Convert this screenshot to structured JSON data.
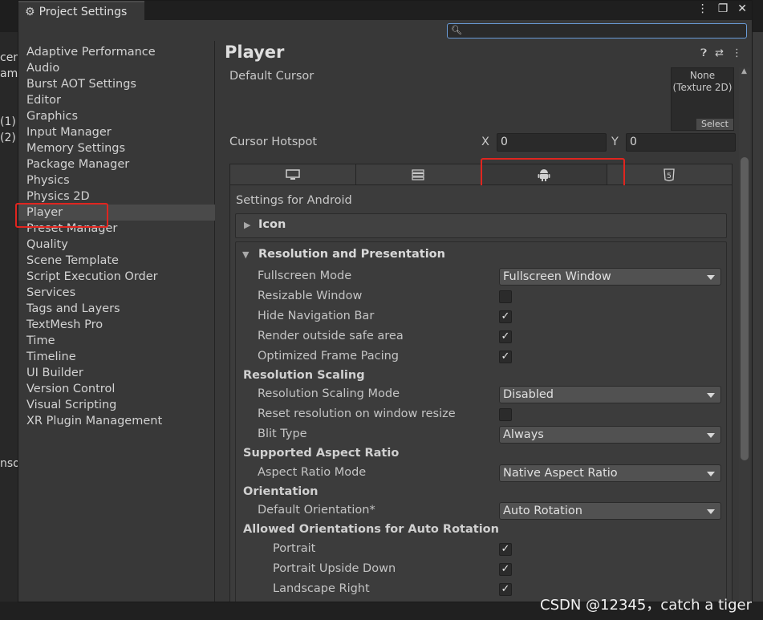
{
  "window": {
    "title": "Project Settings",
    "controls": [
      "⋮",
      "❐",
      "✕"
    ]
  },
  "search": {
    "value": ""
  },
  "background": {
    "fragments": [
      "cen",
      "am",
      "(1)",
      "(2)",
      "nso"
    ]
  },
  "sidebar": {
    "items": [
      {
        "label": "Adaptive Performance"
      },
      {
        "label": "Audio"
      },
      {
        "label": "Burst AOT Settings"
      },
      {
        "label": "Editor"
      },
      {
        "label": "Graphics"
      },
      {
        "label": "Input Manager"
      },
      {
        "label": "Memory Settings"
      },
      {
        "label": "Package Manager"
      },
      {
        "label": "Physics"
      },
      {
        "label": "Physics 2D"
      },
      {
        "label": "Player"
      },
      {
        "label": "Preset Manager"
      },
      {
        "label": "Quality"
      },
      {
        "label": "Scene Template"
      },
      {
        "label": "Script Execution Order"
      },
      {
        "label": "Services"
      },
      {
        "label": "Tags and Layers"
      },
      {
        "label": "TextMesh Pro"
      },
      {
        "label": "Time"
      },
      {
        "label": "Timeline"
      },
      {
        "label": "UI Builder"
      },
      {
        "label": "Version Control"
      },
      {
        "label": "Visual Scripting"
      },
      {
        "label": "XR Plugin Management"
      }
    ],
    "selected": "Player"
  },
  "main": {
    "title": "Player",
    "default_cursor_label": "Default Cursor",
    "cursor_value_line1": "None",
    "cursor_value_line2": "(Texture 2D)",
    "cursor_select": "Select",
    "cursor_hotspot_label": "Cursor Hotspot",
    "x_label": "X",
    "x_value": "0",
    "y_label": "Y",
    "y_value": "0",
    "platform_tabs": [
      "desktop-icon",
      "server-icon",
      "android-icon",
      "html5-icon"
    ],
    "html5_glyph": "5",
    "settings_for": "Settings for Android",
    "icon_foldout": "Icon",
    "resolution_section": "Resolution and Presentation",
    "fullscreen_mode_label": "Fullscreen Mode",
    "fullscreen_mode_value": "Fullscreen Window",
    "resizable_window_label": "Resizable Window",
    "hide_nav_label": "Hide Navigation Bar",
    "render_safe_label": "Render outside safe area",
    "optimized_pacing_label": "Optimized Frame Pacing",
    "resolution_scaling_header": "Resolution Scaling",
    "scaling_mode_label": "Resolution Scaling Mode",
    "scaling_mode_value": "Disabled",
    "reset_resolution_label": "Reset resolution on window resize",
    "blit_type_label": "Blit Type",
    "blit_type_value": "Always",
    "aspect_header": "Supported Aspect Ratio",
    "aspect_mode_label": "Aspect Ratio Mode",
    "aspect_mode_value": "Native Aspect Ratio",
    "orientation_header": "Orientation",
    "default_orientation_label": "Default Orientation*",
    "default_orientation_value": "Auto Rotation",
    "allowed_header": "Allowed Orientations for Auto Rotation",
    "portrait_label": "Portrait",
    "portrait_upside_label": "Portrait Upside Down",
    "landscape_right_label": "Landscape Right",
    "check_mark": "✓"
  },
  "checkbox_states": {
    "resizable_window": false,
    "hide_navigation_bar": true,
    "render_outside_safe_area": true,
    "optimized_frame_pacing": true,
    "reset_resolution_on_window_resize": false,
    "portrait": true,
    "portrait_upside_down": true,
    "landscape_right": true
  },
  "watermark": "CSDN @12345，catch a tiger",
  "colors": {
    "highlight_red": "#e0251f",
    "panel_bg": "#383838",
    "selected_bg": "#4a4a4a"
  }
}
